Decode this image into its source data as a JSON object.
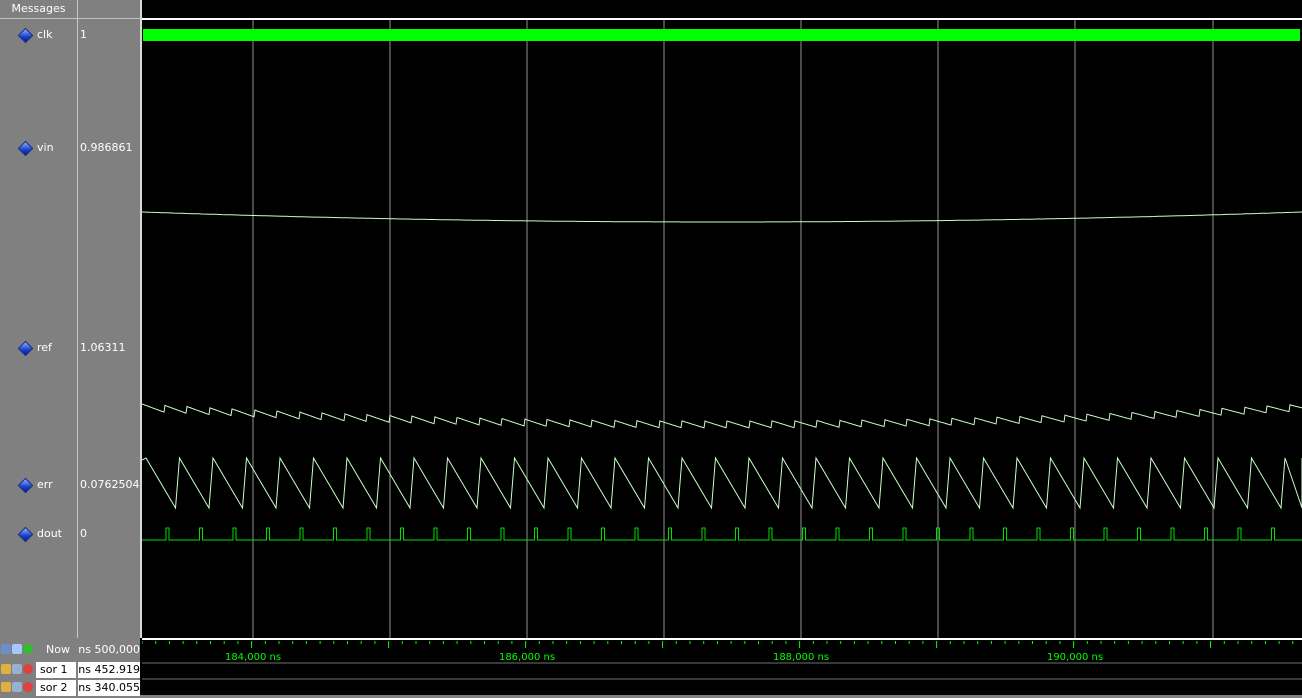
{
  "header": {
    "messages_label": "Messages"
  },
  "signals": [
    {
      "name": "clk",
      "value": "1"
    },
    {
      "name": "vin",
      "value": "0.986861"
    },
    {
      "name": "ref",
      "value": "1.06311"
    },
    {
      "name": "err",
      "value": "0.0762504"
    },
    {
      "name": "dout",
      "value": "0"
    }
  ],
  "cursor_rows": [
    {
      "name": "Now",
      "value": "500,000 ns"
    },
    {
      "name": "sor 1",
      "value": "452.919 ns"
    },
    {
      "name": "sor 2",
      "value": "340.055 ns"
    }
  ],
  "timeline": {
    "labels": [
      "184,000 ns",
      "186,000 ns",
      "188,000 ns",
      "190,000 ns"
    ]
  },
  "colors": {
    "trace": "#c8ffc8",
    "clk": "#00ff00",
    "dout": "#00e000",
    "grid": "#d0d0d0",
    "axis_label": "#00ff00",
    "background": "#000000",
    "panel": "#808080"
  }
}
